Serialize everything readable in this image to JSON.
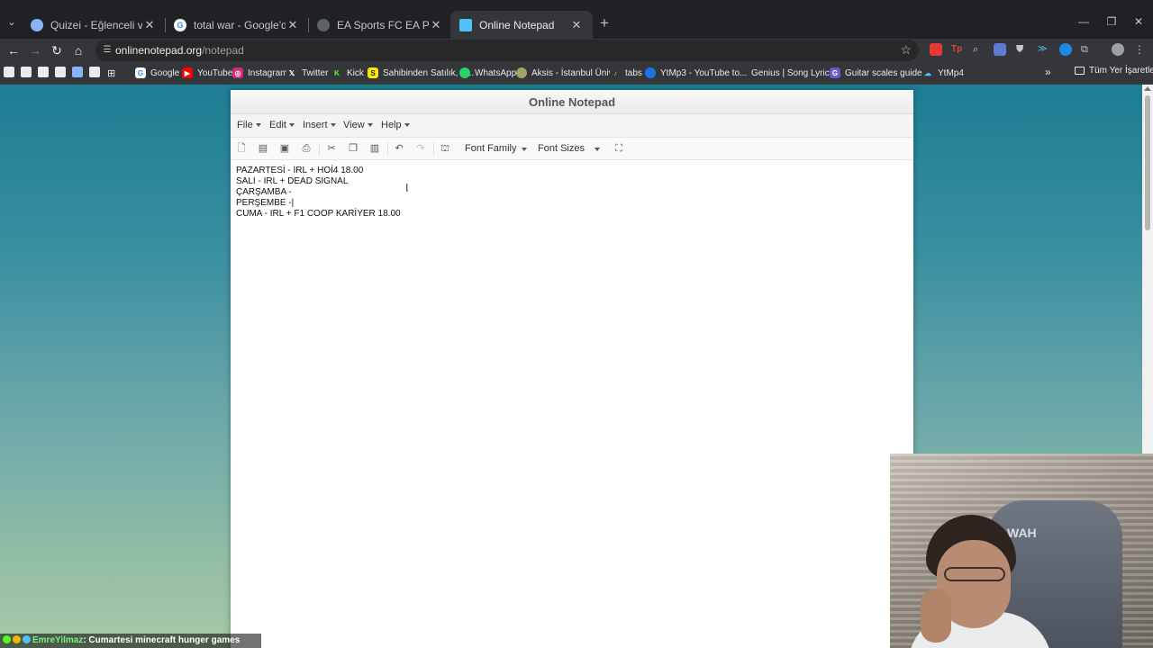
{
  "browser": {
    "tabs": [
      {
        "title": "Quizei - Eğlenceli ve etkileşimli",
        "favicon": "quizei-icon",
        "color": "#8ab4f8",
        "active": false
      },
      {
        "title": "total war - Google'da Ara",
        "favicon": "google-icon",
        "color": "#ffffff",
        "active": false
      },
      {
        "title": "EA Sports FC EA Play - EA Resmi",
        "favicon": "ea-icon",
        "color": "#9aa0a6",
        "active": false
      },
      {
        "title": "Online Notepad",
        "favicon": "notepad-icon",
        "color": "#4fc3f7",
        "active": true
      }
    ],
    "url_domain": "onlinenotepad.org",
    "url_path": "/notepad"
  },
  "bookmarks": [
    {
      "label": "Google",
      "icon": "google-icon",
      "color": "#ffffff"
    },
    {
      "label": "YouTube",
      "icon": "youtube-icon",
      "color": "#ff0000"
    },
    {
      "label": "Instagram",
      "icon": "instagram-icon",
      "color": "#d62976"
    },
    {
      "label": "Twitter",
      "icon": "x-icon",
      "color": "#35363a"
    },
    {
      "label": "Kick",
      "icon": "kick-icon",
      "color": "#53fc18"
    },
    {
      "label": "Sahibinden Satılık, K...",
      "icon": "sahibinden-icon",
      "color": "#ffe800"
    },
    {
      "label": "WhatsApp",
      "icon": "whatsapp-icon",
      "color": "#25d366"
    },
    {
      "label": "Aksis - İstanbul Üniv...",
      "icon": "aksis-icon",
      "color": "#a1a365"
    },
    {
      "label": "tabs",
      "icon": "tabs-icon",
      "color": "#f4b400"
    },
    {
      "label": "YtMp3 - YouTube to...",
      "icon": "ytmp3-icon",
      "color": "#1a73e8"
    },
    {
      "label": "Genius | Song Lyrics...",
      "icon": "genius-icon",
      "color": "#ffff64"
    },
    {
      "label": "Guitar scales guide...",
      "icon": "guitar-icon",
      "color": "#6a5acd"
    },
    {
      "label": "YtMp4",
      "icon": "ytmp4-icon",
      "color": "#4fc3f7"
    }
  ],
  "bookmarks_folder": "Tüm Yer İşaretleri",
  "notepad": {
    "title": "Online Notepad",
    "menu": [
      "File",
      "Edit",
      "Insert",
      "View",
      "Help"
    ],
    "font_family_label": "Font Family",
    "font_sizes_label": "Font Sizes",
    "lines": [
      "PAZARTESİ -  IRL + HOİ4 18.00",
      "SALI - IRL + DEAD SIGNAL",
      "ÇARŞAMBA -",
      "PERŞEMBE -|",
      "CUMA - IRL + F1 COOP KARİYER 18.00"
    ]
  },
  "webcam": {
    "chair_text": "WAH"
  },
  "chat": {
    "username": "EmreYilmaz",
    "message": ": Cumartesi minecraft hunger games"
  }
}
